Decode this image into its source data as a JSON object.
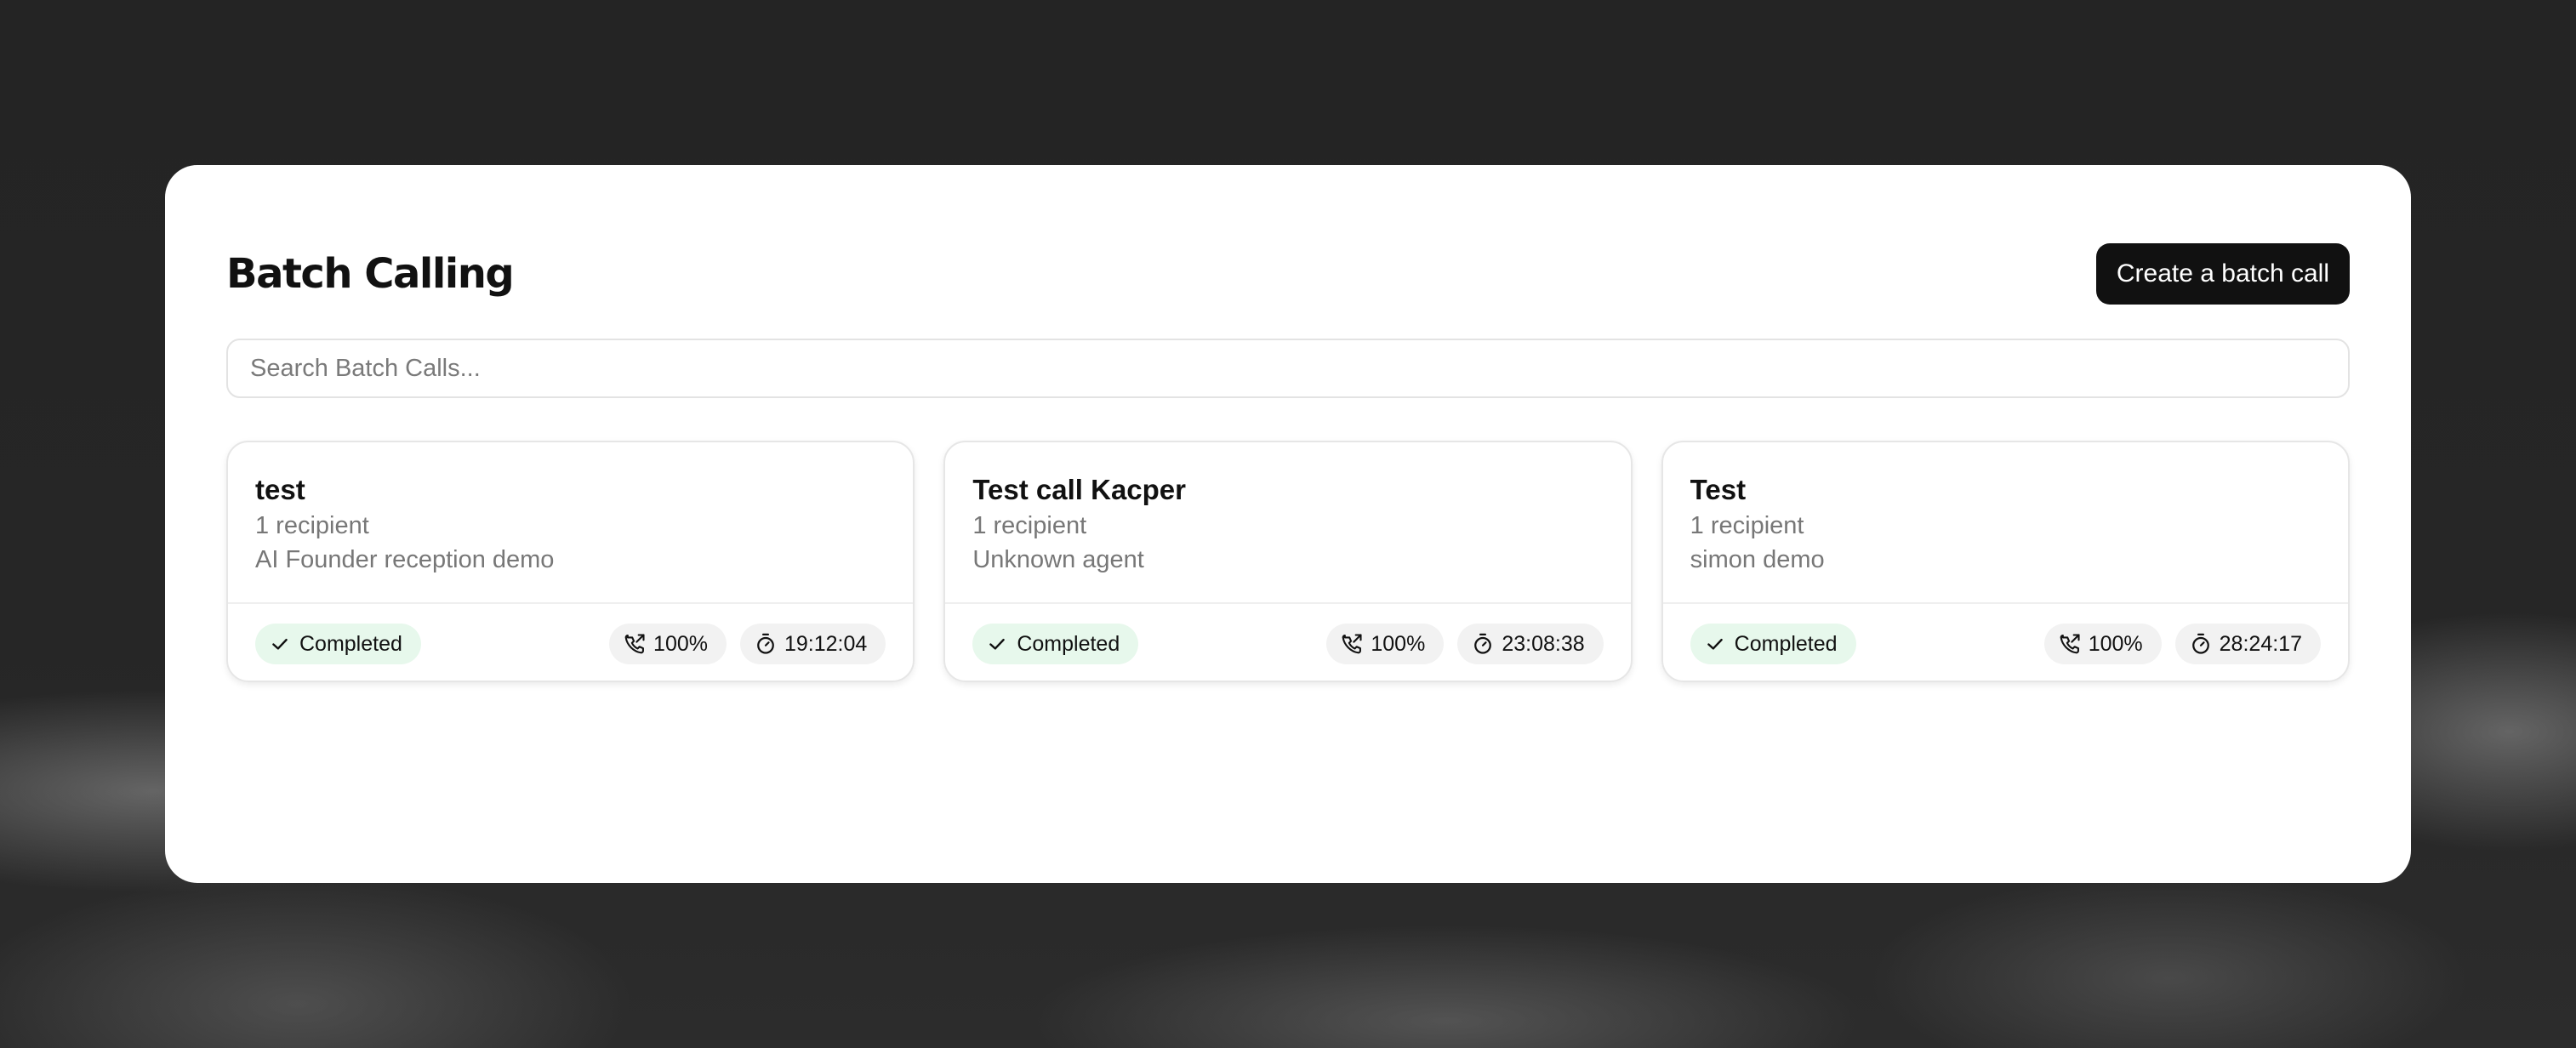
{
  "page": {
    "title": "Batch Calling",
    "create_button": "Create a batch call"
  },
  "search": {
    "placeholder": "Search Batch Calls..."
  },
  "batches": [
    {
      "name": "test",
      "recipients": "1 recipient",
      "agent": "AI Founder reception demo",
      "status": "Completed",
      "success_rate": "100%",
      "duration": "19:12:04"
    },
    {
      "name": "Test call Kacper",
      "recipients": "1 recipient",
      "agent": "Unknown agent",
      "status": "Completed",
      "success_rate": "100%",
      "duration": "23:08:38"
    },
    {
      "name": "Test",
      "recipients": "1 recipient",
      "agent": "simon demo",
      "status": "Completed",
      "success_rate": "100%",
      "duration": "28:24:17"
    }
  ],
  "icons": {
    "status": "check-icon",
    "rate": "phone-outgoing-icon",
    "duration": "stopwatch-icon"
  },
  "colors": {
    "primary_button": "#111111",
    "completed_badge_bg": "#e7f8ec",
    "chip_bg": "#f2f2f2"
  }
}
